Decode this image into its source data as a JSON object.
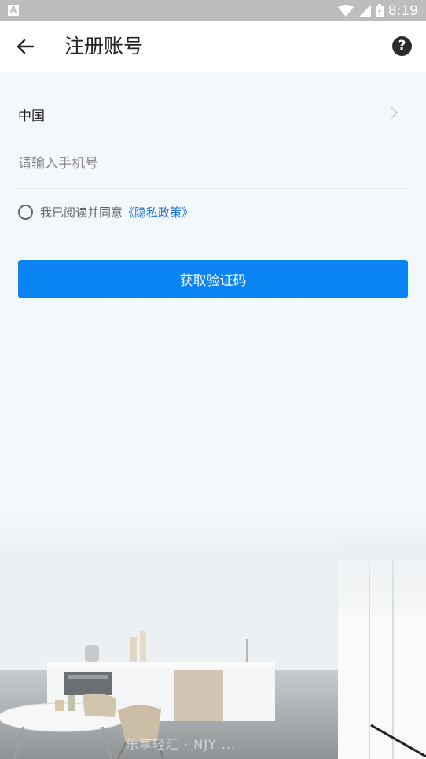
{
  "status_bar": {
    "time": "8:19",
    "app_badge": "A"
  },
  "header": {
    "title": "注册账号"
  },
  "form": {
    "country": "中国",
    "phone_placeholder": "请输入手机号",
    "phone_value": "",
    "agree_text": "我已阅读并同意",
    "policy_link": "《隐私政策》",
    "submit_label": "获取验证码"
  },
  "footer": {
    "watermark": "乐享轻汇 · NJY ..."
  },
  "colors": {
    "primary": "#0a84f5",
    "link": "#1e73e8",
    "status_bar": "#bdbdbd"
  }
}
